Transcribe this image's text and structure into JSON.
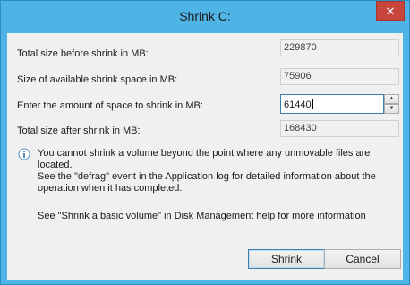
{
  "window": {
    "title": "Shrink C:",
    "close_glyph": "✕"
  },
  "fields": {
    "total_before": {
      "label": "Total size before shrink in MB:",
      "value": "229870"
    },
    "available": {
      "label": "Size of available shrink space in MB:",
      "value": "75906"
    },
    "amount": {
      "label": "Enter the amount of space to shrink in MB:",
      "value": "61440"
    },
    "total_after": {
      "label": "Total size after shrink in MB:",
      "value": "168430"
    }
  },
  "info": {
    "icon": "info-icon",
    "line1": "You cannot shrink a volume beyond the point where any unmovable files are located.",
    "line2": "See the \"defrag\" event in the Application log for detailed information about the",
    "line3": "operation when it has completed."
  },
  "help": {
    "text": "See \"Shrink a basic volume\" in Disk Management help for more information"
  },
  "buttons": {
    "shrink": "Shrink",
    "cancel": "Cancel"
  },
  "colors": {
    "title_bar": "#4fb4e5",
    "close_button": "#c7453d",
    "dialog_background": "#f0f0f0",
    "focus_border": "#3c7fb1"
  }
}
